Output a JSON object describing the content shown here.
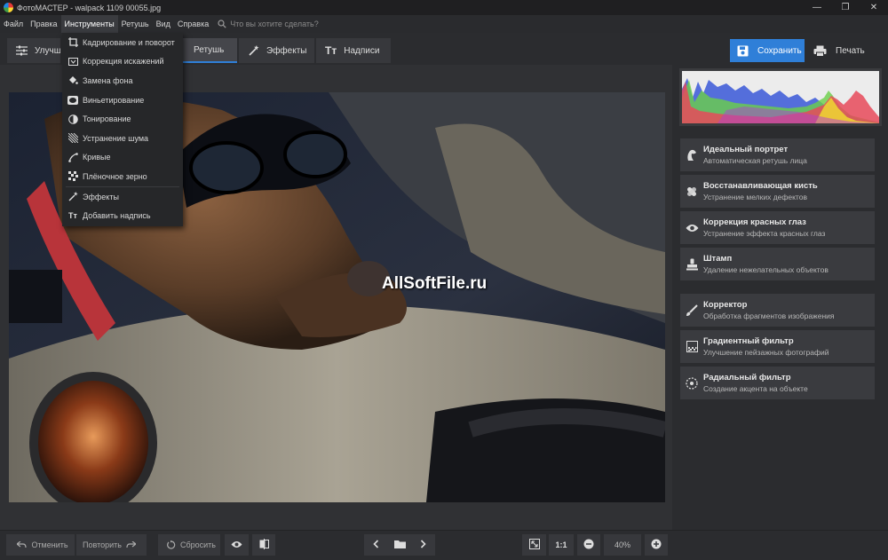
{
  "window": {
    "title": "ФотоМАСТЕР - walpack 1109 00055.jpg"
  },
  "menu": {
    "items": [
      "Файл",
      "Правка",
      "Инструменты",
      "Ретушь",
      "Вид",
      "Справка"
    ],
    "search_placeholder": "Что вы хотите сделать?"
  },
  "tabs": [
    "Улучшение",
    "Ретушь",
    "Эффекты",
    "Надписи"
  ],
  "actions": {
    "save": "Сохранить",
    "print": "Печать"
  },
  "dropdown": [
    {
      "label": "Кадрирование и поворот",
      "icon": "crop-icon"
    },
    {
      "label": "Коррекция искажений",
      "icon": "distortion-icon"
    },
    {
      "label": "Замена фона",
      "icon": "bucket-icon"
    },
    {
      "label": "Виньетирование",
      "icon": "vignette-icon"
    },
    {
      "label": "Тонирование",
      "icon": "toning-icon"
    },
    {
      "label": "Устранение шума",
      "icon": "noise-icon"
    },
    {
      "label": "Кривые",
      "icon": "curves-icon"
    },
    {
      "label": "Плёночное зерно",
      "icon": "grain-icon"
    },
    {
      "label": "Эффекты",
      "icon": "wand-icon"
    },
    {
      "label": "Добавить надпись",
      "icon": "text-icon"
    }
  ],
  "watermark": "AllSoftFile.ru",
  "tools": [
    {
      "title": "Идеальный портрет",
      "subtitle": "Автоматическая ретушь лица",
      "icon": "portrait-icon"
    },
    {
      "title": "Восстанавливающая кисть",
      "subtitle": "Устранение мелких дефектов",
      "icon": "bandage-icon"
    },
    {
      "title": "Коррекция красных глаз",
      "subtitle": "Устранение эффекта красных глаз",
      "icon": "eye-icon"
    },
    {
      "title": "Штамп",
      "subtitle": "Удаление нежелательных объектов",
      "icon": "stamp-icon"
    },
    {
      "title": "Корректор",
      "subtitle": "Обработка фрагментов изображения",
      "icon": "brush-icon"
    },
    {
      "title": "Градиентный фильтр",
      "subtitle": "Улучшение пейзажных фотографий",
      "icon": "gradient-icon"
    },
    {
      "title": "Радиальный фильтр",
      "subtitle": "Создание акцента на объекте",
      "icon": "radial-icon"
    }
  ],
  "bottom": {
    "undo": "Отменить",
    "redo": "Повторить",
    "reset": "Сбросить",
    "one_to_one": "1:1",
    "zoom": "40%"
  },
  "colors": {
    "accent": "#2f7fd8",
    "background": "#2b2c2f",
    "panel": "#3a3b3f"
  }
}
